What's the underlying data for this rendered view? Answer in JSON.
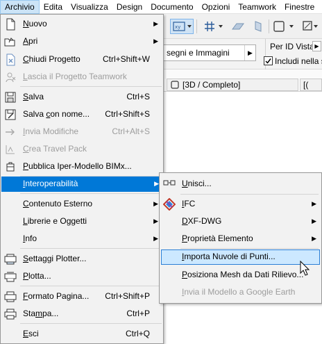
{
  "menubar": {
    "items": [
      "Archivio",
      "Edita",
      "Visualizza",
      "Design",
      "Documento",
      "Opzioni",
      "Teamwork",
      "Finestre"
    ]
  },
  "background": {
    "group_label": "segni e Immagini",
    "view_filter": "Per ID Vista",
    "include_checkbox": "Includi nella s",
    "include_checked": true,
    "view_tab": "[3D / Completo]",
    "view_tab2": "[("
  },
  "archivio_menu": {
    "items": [
      {
        "id": "nuovo",
        "label": "Nuovo",
        "u": 0,
        "icon": "new-file-icon",
        "submenu": true
      },
      {
        "id": "apri",
        "label": "Apri",
        "u": 0,
        "icon": "open-folder-icon",
        "submenu": true
      },
      {
        "id": "chiudi-progetto",
        "label": "Chiudi Progetto",
        "u": 0,
        "icon": "close-project-icon",
        "shortcut": "Ctrl+Shift+W"
      },
      {
        "id": "lascia-progetto",
        "label": "Lascia il Progetto Teamwork",
        "u": 0,
        "icon": "teamwork-leave-icon",
        "disabled": true
      },
      {
        "id": "salva",
        "label": "Salva",
        "u": 0,
        "icon": "save-icon",
        "shortcut": "Ctrl+S"
      },
      {
        "id": "salva-con-nome",
        "label": "Salva con nome...",
        "u": 6,
        "icon": "save-as-icon",
        "shortcut": "Ctrl+Shift+S"
      },
      {
        "id": "invia-modifiche",
        "label": "Invia Modifiche",
        "u": 0,
        "icon": "send-changes-icon",
        "shortcut": "Ctrl+Alt+S",
        "disabled": true
      },
      {
        "id": "crea-travel-pack",
        "label": "Crea Travel Pack",
        "u": 0,
        "icon": "travel-pack-icon",
        "disabled": true
      },
      {
        "id": "pubblica-bimx",
        "label": "Pubblica Iper-Modello BIMx...",
        "u": 0,
        "icon": "bimx-icon"
      },
      {
        "id": "interoperabilita",
        "label": "Interoperabilità",
        "u": 0,
        "submenu": true,
        "highlight": true
      },
      {
        "id": "contenuto-esterno",
        "label": "Contenuto Esterno",
        "u": 0,
        "submenu": true
      },
      {
        "id": "librerie-oggetti",
        "label": "Librerie e Oggetti",
        "u": 0,
        "submenu": true
      },
      {
        "id": "info",
        "label": "Info",
        "u": 0,
        "submenu": true
      },
      {
        "id": "settaggi-plotter",
        "label": "Settaggi Plotter...",
        "u": 0,
        "icon": "plotter-settings-icon"
      },
      {
        "id": "plotta",
        "label": "Plotta...",
        "u": 0,
        "icon": "plotter-icon"
      },
      {
        "id": "formato-pagina",
        "label": "Formato Pagina...",
        "u": 0,
        "icon": "page-setup-icon",
        "shortcut": "Ctrl+Shift+P"
      },
      {
        "id": "stampa",
        "label": "Stampa...",
        "u": 3,
        "icon": "printer-icon",
        "shortcut": "Ctrl+P"
      },
      {
        "id": "esci",
        "label": "Esci",
        "u": 0,
        "shortcut": "Ctrl+Q"
      }
    ]
  },
  "interop_submenu": {
    "items": [
      {
        "id": "unisci",
        "label": "Unisci...",
        "u": 0,
        "icon": "merge-icon"
      },
      {
        "id": "ifc",
        "label": "IFC",
        "u": 0,
        "icon": "ifc-icon",
        "submenu": true
      },
      {
        "id": "dxf-dwg",
        "label": "DXF-DWG",
        "u": 0,
        "submenu": true
      },
      {
        "id": "proprieta-elemento",
        "label": "Proprietà Elemento",
        "u": 0,
        "submenu": true
      },
      {
        "id": "importa-nuvole",
        "label": "Importa Nuvole di Punti...",
        "u": 0,
        "hover": true
      },
      {
        "id": "posiziona-mesh",
        "label": "Posiziona Mesh da Dati Rilievo...",
        "u": 0
      },
      {
        "id": "invia-google-earth",
        "label": "Invia il Modello a Google Earth",
        "u": 0,
        "disabled": true
      }
    ]
  }
}
